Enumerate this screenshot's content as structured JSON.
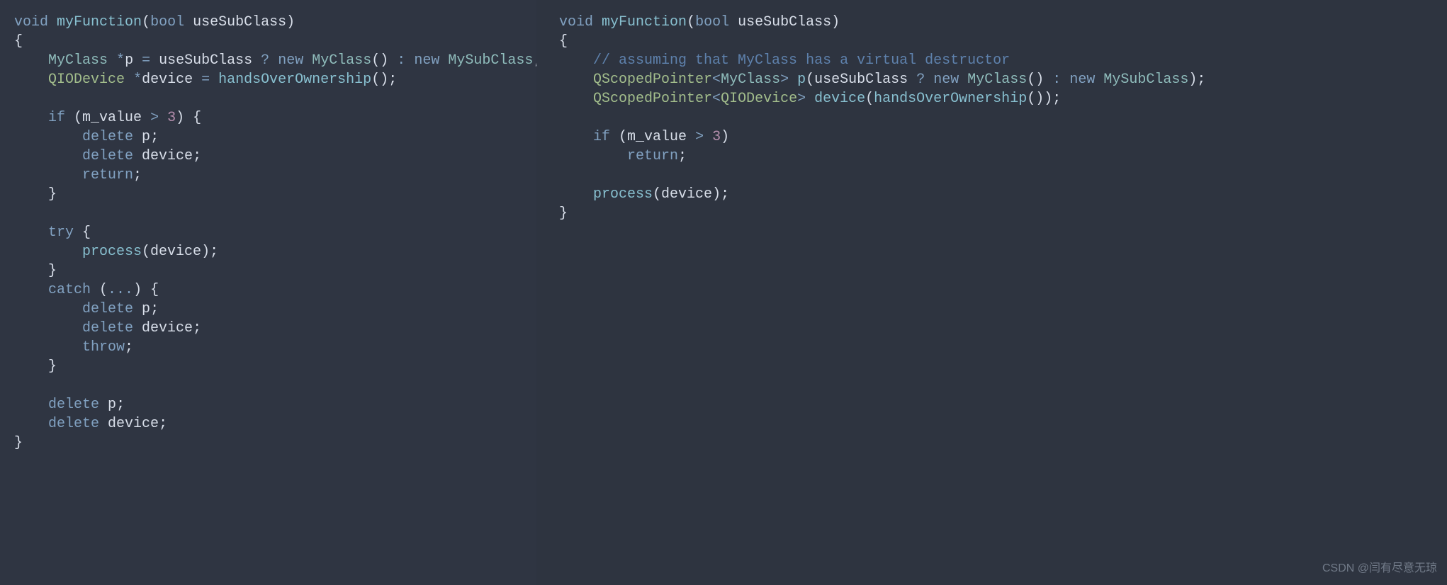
{
  "watermark": "CSDN @闫有尽意无琼",
  "left": {
    "tokens": [
      [
        [
          "kw",
          "void"
        ],
        [
          "pn",
          " "
        ],
        [
          "fn",
          "myFunction"
        ],
        [
          "pn",
          "("
        ],
        [
          "kw",
          "bool"
        ],
        [
          "pn",
          " "
        ],
        [
          "id",
          "useSubClass"
        ],
        [
          "pn",
          ")"
        ]
      ],
      [
        [
          "pn",
          "{"
        ]
      ],
      [
        [
          "pn",
          "    "
        ],
        [
          "typ",
          "MyClass"
        ],
        [
          "pn",
          " "
        ],
        [
          "op",
          "*"
        ],
        [
          "id",
          "p"
        ],
        [
          "pn",
          " "
        ],
        [
          "op",
          "="
        ],
        [
          "pn",
          " "
        ],
        [
          "id",
          "useSubClass"
        ],
        [
          "pn",
          " "
        ],
        [
          "op",
          "?"
        ],
        [
          "pn",
          " "
        ],
        [
          "kw",
          "new"
        ],
        [
          "pn",
          " "
        ],
        [
          "typ",
          "MyClass"
        ],
        [
          "pn",
          "()"
        ],
        [
          "pn",
          " "
        ],
        [
          "op",
          ":"
        ],
        [
          "pn",
          " "
        ],
        [
          "kw",
          "new"
        ],
        [
          "pn",
          " "
        ],
        [
          "typ",
          "MySubClass"
        ],
        [
          "pn",
          ";"
        ]
      ],
      [
        [
          "pn",
          "    "
        ],
        [
          "typ2",
          "QIODevice"
        ],
        [
          "pn",
          " "
        ],
        [
          "op",
          "*"
        ],
        [
          "id",
          "device"
        ],
        [
          "pn",
          " "
        ],
        [
          "op",
          "="
        ],
        [
          "pn",
          " "
        ],
        [
          "fn",
          "handsOverOwnership"
        ],
        [
          "pn",
          "();"
        ]
      ],
      [
        [
          "pn",
          ""
        ]
      ],
      [
        [
          "pn",
          "    "
        ],
        [
          "kw",
          "if"
        ],
        [
          "pn",
          " ("
        ],
        [
          "id",
          "m_value"
        ],
        [
          "pn",
          " "
        ],
        [
          "op",
          ">"
        ],
        [
          "pn",
          " "
        ],
        [
          "num",
          "3"
        ],
        [
          "pn",
          ") {"
        ]
      ],
      [
        [
          "pn",
          "        "
        ],
        [
          "kw",
          "delete"
        ],
        [
          "pn",
          " "
        ],
        [
          "id",
          "p"
        ],
        [
          "pn",
          ";"
        ]
      ],
      [
        [
          "pn",
          "        "
        ],
        [
          "kw",
          "delete"
        ],
        [
          "pn",
          " "
        ],
        [
          "id",
          "device"
        ],
        [
          "pn",
          ";"
        ]
      ],
      [
        [
          "pn",
          "        "
        ],
        [
          "kw",
          "return"
        ],
        [
          "pn",
          ";"
        ]
      ],
      [
        [
          "pn",
          "    }"
        ]
      ],
      [
        [
          "pn",
          ""
        ]
      ],
      [
        [
          "pn",
          "    "
        ],
        [
          "kw",
          "try"
        ],
        [
          "pn",
          " {"
        ]
      ],
      [
        [
          "pn",
          "        "
        ],
        [
          "fn",
          "process"
        ],
        [
          "pn",
          "("
        ],
        [
          "id",
          "device"
        ],
        [
          "pn",
          ");"
        ]
      ],
      [
        [
          "pn",
          "    }"
        ]
      ],
      [
        [
          "pn",
          "    "
        ],
        [
          "kw",
          "catch"
        ],
        [
          "pn",
          " ("
        ],
        [
          "op",
          "..."
        ],
        [
          "pn",
          ") {"
        ]
      ],
      [
        [
          "pn",
          "        "
        ],
        [
          "kw",
          "delete"
        ],
        [
          "pn",
          " "
        ],
        [
          "id",
          "p"
        ],
        [
          "pn",
          ";"
        ]
      ],
      [
        [
          "pn",
          "        "
        ],
        [
          "kw",
          "delete"
        ],
        [
          "pn",
          " "
        ],
        [
          "id",
          "device"
        ],
        [
          "pn",
          ";"
        ]
      ],
      [
        [
          "pn",
          "        "
        ],
        [
          "kw",
          "throw"
        ],
        [
          "pn",
          ";"
        ]
      ],
      [
        [
          "pn",
          "    }"
        ]
      ],
      [
        [
          "pn",
          ""
        ]
      ],
      [
        [
          "pn",
          "    "
        ],
        [
          "kw",
          "delete"
        ],
        [
          "pn",
          " "
        ],
        [
          "id",
          "p"
        ],
        [
          "pn",
          ";"
        ]
      ],
      [
        [
          "pn",
          "    "
        ],
        [
          "kw",
          "delete"
        ],
        [
          "pn",
          " "
        ],
        [
          "id",
          "device"
        ],
        [
          "pn",
          ";"
        ]
      ],
      [
        [
          "pn",
          "}"
        ]
      ]
    ]
  },
  "right": {
    "tokens": [
      [
        [
          "kw",
          "void"
        ],
        [
          "pn",
          " "
        ],
        [
          "fn",
          "myFunction"
        ],
        [
          "pn",
          "("
        ],
        [
          "kw",
          "bool"
        ],
        [
          "pn",
          " "
        ],
        [
          "id",
          "useSubClass"
        ],
        [
          "pn",
          ")"
        ]
      ],
      [
        [
          "pn",
          "{"
        ]
      ],
      [
        [
          "pn",
          "    "
        ],
        [
          "com",
          "// assuming that MyClass has a virtual destructor"
        ]
      ],
      [
        [
          "pn",
          "    "
        ],
        [
          "typ2",
          "QScopedPointer"
        ],
        [
          "op",
          "<"
        ],
        [
          "typ",
          "MyClass"
        ],
        [
          "op",
          ">"
        ],
        [
          "pn",
          " "
        ],
        [
          "fn",
          "p"
        ],
        [
          "pn",
          "("
        ],
        [
          "id",
          "useSubClass"
        ],
        [
          "pn",
          " "
        ],
        [
          "op",
          "?"
        ],
        [
          "pn",
          " "
        ],
        [
          "kw",
          "new"
        ],
        [
          "pn",
          " "
        ],
        [
          "typ",
          "MyClass"
        ],
        [
          "pn",
          "()"
        ],
        [
          "pn",
          " "
        ],
        [
          "op",
          ":"
        ],
        [
          "pn",
          " "
        ],
        [
          "kw",
          "new"
        ],
        [
          "pn",
          " "
        ],
        [
          "typ",
          "MySubClass"
        ],
        [
          "pn",
          ");"
        ]
      ],
      [
        [
          "pn",
          "    "
        ],
        [
          "typ2",
          "QScopedPointer"
        ],
        [
          "op",
          "<"
        ],
        [
          "typ2",
          "QIODevice"
        ],
        [
          "op",
          ">"
        ],
        [
          "pn",
          " "
        ],
        [
          "fn",
          "device"
        ],
        [
          "pn",
          "("
        ],
        [
          "fn",
          "handsOverOwnership"
        ],
        [
          "pn",
          "());"
        ]
      ],
      [
        [
          "pn",
          ""
        ]
      ],
      [
        [
          "pn",
          "    "
        ],
        [
          "kw",
          "if"
        ],
        [
          "pn",
          " ("
        ],
        [
          "id",
          "m_value"
        ],
        [
          "pn",
          " "
        ],
        [
          "op",
          ">"
        ],
        [
          "pn",
          " "
        ],
        [
          "num",
          "3"
        ],
        [
          "pn",
          ")"
        ]
      ],
      [
        [
          "pn",
          "        "
        ],
        [
          "kw",
          "return"
        ],
        [
          "pn",
          ";"
        ]
      ],
      [
        [
          "pn",
          ""
        ]
      ],
      [
        [
          "pn",
          "    "
        ],
        [
          "fn",
          "process"
        ],
        [
          "pn",
          "("
        ],
        [
          "id",
          "device"
        ],
        [
          "pn",
          ");"
        ]
      ],
      [
        [
          "pn",
          "}"
        ]
      ]
    ]
  }
}
